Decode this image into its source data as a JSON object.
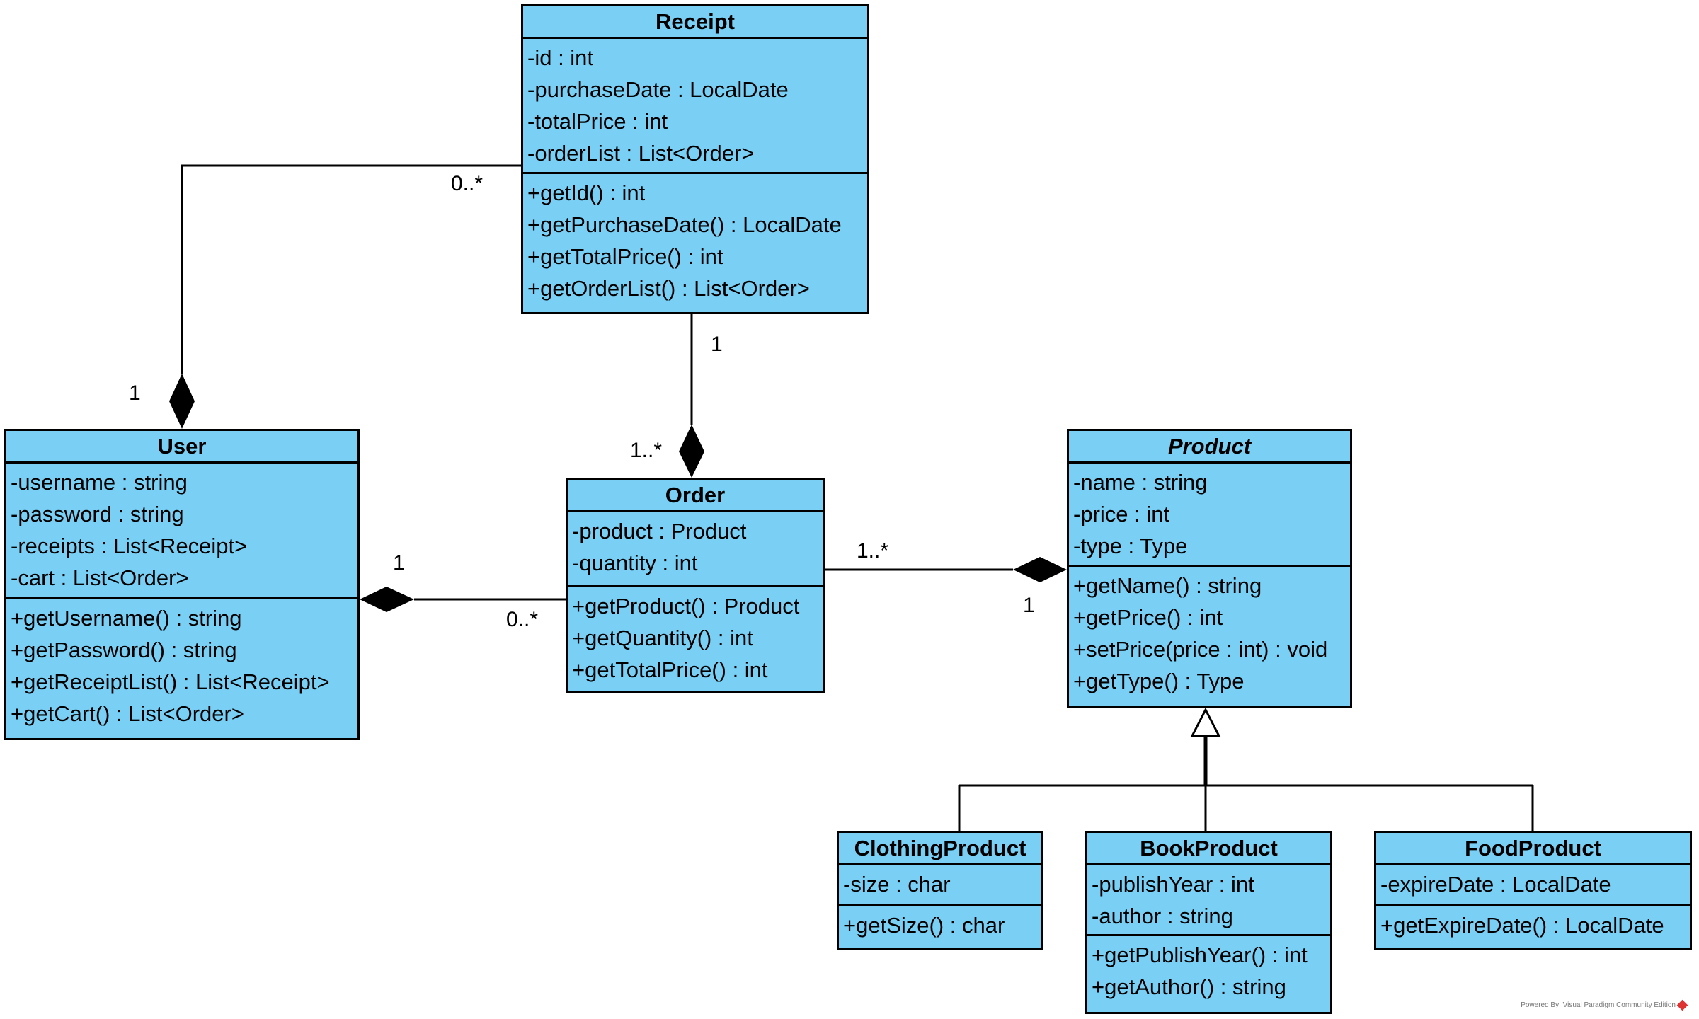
{
  "colors": {
    "class_fill": "#7ACFF5",
    "line": "#000000"
  },
  "classes": [
    {
      "id": "receipt",
      "name": "Receipt",
      "abstract": false,
      "attributes": [
        "-id : int",
        "-purchaseDate : LocalDate",
        "-totalPrice : int",
        "-orderList : List<Order>"
      ],
      "operations": [
        "+getId() : int",
        "+getPurchaseDate() : LocalDate",
        "+getTotalPrice() : int",
        "+getOrderList() : List<Order>"
      ]
    },
    {
      "id": "user",
      "name": "User",
      "abstract": false,
      "attributes": [
        "-username : string",
        "-password : string",
        "-receipts : List<Receipt>",
        "-cart : List<Order>"
      ],
      "operations": [
        "+getUsername() : string",
        "+getPassword() : string",
        "+getReceiptList() : List<Receipt>",
        "+getCart() : List<Order>"
      ]
    },
    {
      "id": "order",
      "name": "Order",
      "abstract": false,
      "attributes": [
        "-product : Product",
        "-quantity : int"
      ],
      "operations": [
        "+getProduct() : Product",
        "+getQuantity() : int",
        "+getTotalPrice() : int"
      ]
    },
    {
      "id": "product",
      "name": "Product",
      "abstract": true,
      "attributes": [
        "-name : string",
        "-price : int",
        "-type : Type"
      ],
      "operations": [
        "+getName() : string",
        "+getPrice() : int",
        "+setPrice(price : int) : void",
        "+getType() : Type"
      ]
    },
    {
      "id": "clothing",
      "name": "ClothingProduct",
      "abstract": false,
      "attributes": [
        "-size : char"
      ],
      "operations": [
        "+getSize() : char"
      ]
    },
    {
      "id": "book",
      "name": "BookProduct",
      "abstract": false,
      "attributes": [
        "-publishYear : int",
        "-author : string"
      ],
      "operations": [
        "+getPublishYear() : int",
        "+getAuthor() : string"
      ]
    },
    {
      "id": "food",
      "name": "FoodProduct",
      "abstract": false,
      "attributes": [
        "-expireDate : LocalDate"
      ],
      "operations": [
        "+getExpireDate() : LocalDate"
      ]
    }
  ],
  "associations": [
    {
      "id": "user-receipt",
      "type": "composition",
      "whole": "User",
      "part": "Receipt",
      "whole_mult": "1",
      "part_mult": "0..*"
    },
    {
      "id": "receipt-order",
      "type": "composition",
      "whole": "Order",
      "part": "Receipt",
      "whole_mult": "1..*",
      "part_mult": "1"
    },
    {
      "id": "user-order",
      "type": "composition",
      "whole": "User",
      "part": "Order",
      "whole_mult": "1",
      "part_mult": "0..*"
    },
    {
      "id": "order-product",
      "type": "composition",
      "whole": "Product",
      "part": "Order",
      "whole_mult": "1",
      "part_mult": "1..*"
    }
  ],
  "generalizations": [
    {
      "parent": "Product",
      "children": [
        "ClothingProduct",
        "BookProduct",
        "FoodProduct"
      ]
    }
  ],
  "watermark": "Powered By: Visual Paradigm Community Edition"
}
